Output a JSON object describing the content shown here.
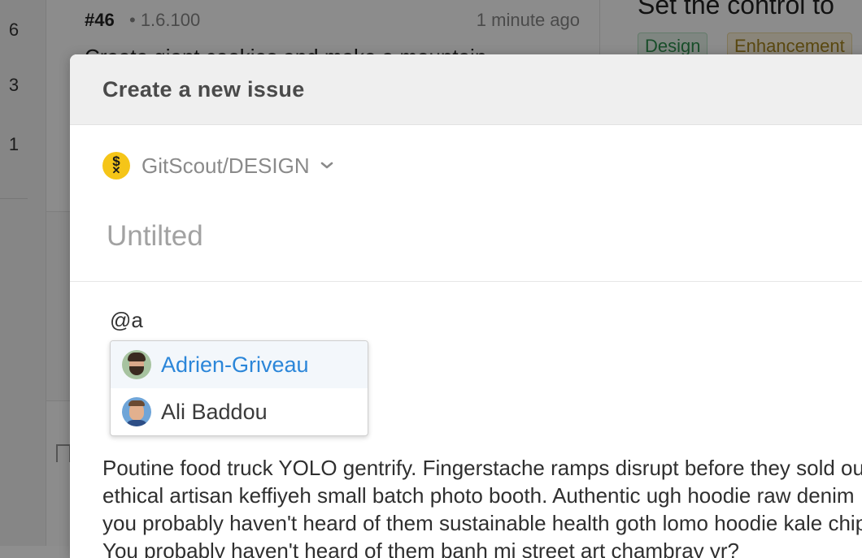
{
  "background": {
    "left_counts": [
      "6",
      "3",
      "1"
    ],
    "issue": {
      "number": "#46",
      "version": "• 1.6.100",
      "time": "1 minute ago",
      "title": "Create giant cookies and make a mountain"
    },
    "detail": {
      "title": "Set the control to",
      "tags": [
        "Design",
        "Enhancement"
      ]
    }
  },
  "modal": {
    "title": "Create a new issue",
    "repo": {
      "name": "GitScout/DESIGN",
      "logo_icon": "gitscout-logo-icon",
      "chevron_icon": "chevron-down-icon"
    },
    "issue_title_placeholder": "Untilted",
    "body": {
      "mention_query": "@a",
      "suggestions": [
        {
          "name": "Adrien-Griveau",
          "active": true
        },
        {
          "name": "Ali Baddou",
          "active": false
        }
      ],
      "lines": [
        "Poutine food truck YOLO gentrify. Fingerstache ramps disrupt before they sold out",
        "ethical artisan keffiyeh small batch photo booth. Authentic ugh hoodie raw denim",
        "you probably haven't heard of them sustainable health goth lomo hoodie kale chips.",
        "You probably haven't heard of them banh mi street art chambray yr?"
      ]
    }
  },
  "colors": {
    "accent": "#2b86d9",
    "logo_yellow": "#f5c518",
    "tag_design": "#2f8f4e",
    "tag_enhancement": "#a5831e"
  }
}
